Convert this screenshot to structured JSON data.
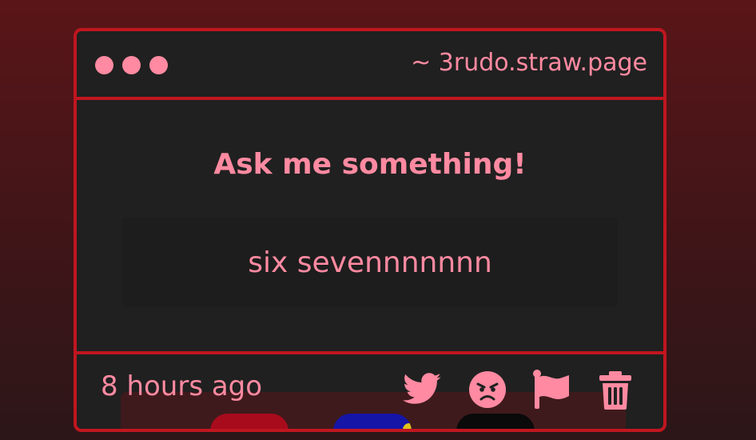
{
  "window": {
    "url": "~ 3rudo.straw.page"
  },
  "prompt": {
    "heading": "Ask me something!",
    "question": "six sevennnnnnn"
  },
  "footer": {
    "timestamp": "8 hours ago",
    "actions": [
      {
        "name": "twitter-icon"
      },
      {
        "name": "angry-face-icon"
      },
      {
        "name": "flag-icon"
      },
      {
        "name": "trash-icon"
      }
    ]
  },
  "dock": {
    "apps": [
      {
        "name": "red-app-icon"
      },
      {
        "name": "blue-app-icon"
      },
      {
        "name": "black-app-icon"
      }
    ]
  },
  "colors": {
    "accent": "#ff8aa1",
    "border": "#c0161f",
    "card_bg": "#202020"
  }
}
